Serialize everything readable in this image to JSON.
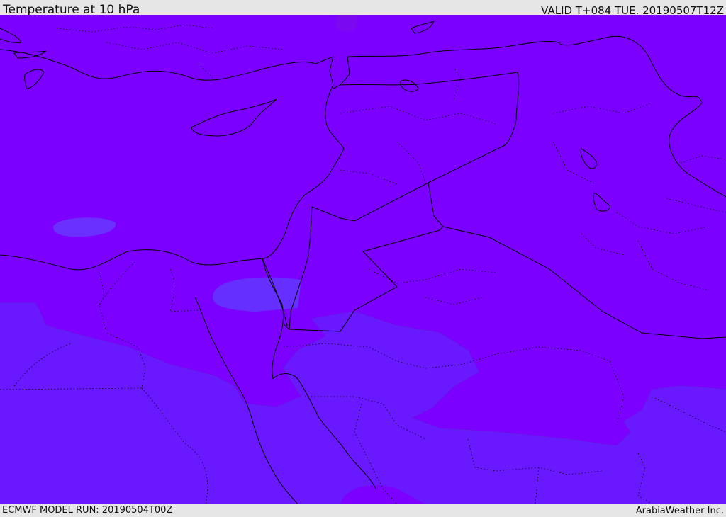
{
  "header": {
    "title": "Temperature at 10 hPa",
    "valid": "VALID T+084 TUE. 20190507T12Z"
  },
  "footer": {
    "model_run": "ECMWF MODEL RUN: 20190504T00Z",
    "credit": "ArabiaWeather Inc."
  },
  "colors": {
    "field_main": "#7b00ff",
    "field_cool": "#6a18ff",
    "field_cooler": "#6530ff",
    "borders": "#000000"
  }
}
